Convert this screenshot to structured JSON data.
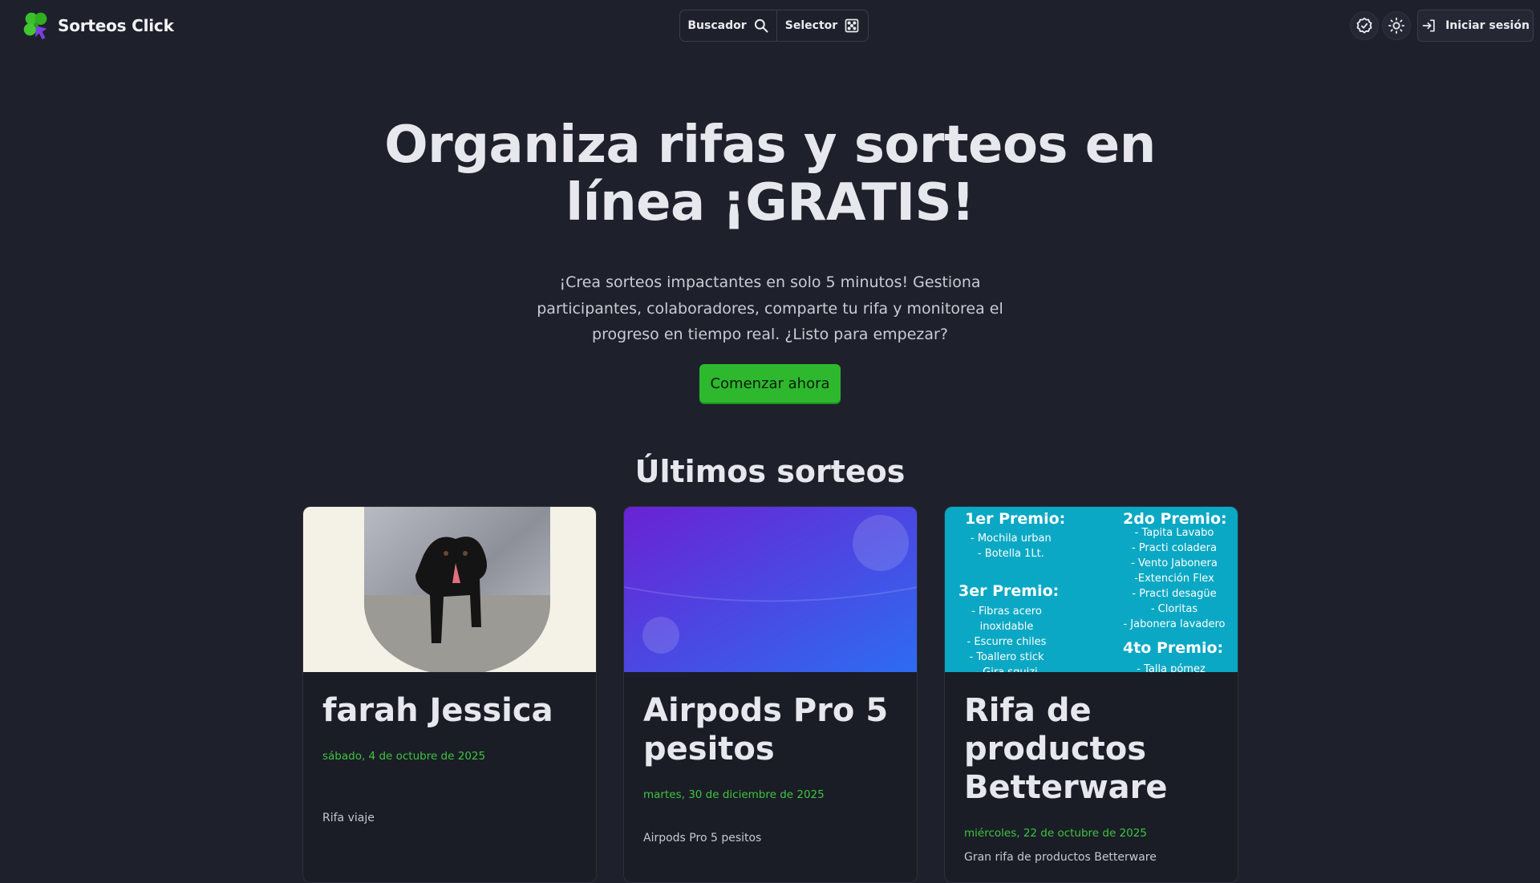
{
  "header": {
    "brand": "Sorteos Click",
    "search_label": "Buscador",
    "selector_label": "Selector",
    "login_label": "Iniciar sesión",
    "icons": [
      "clover-logo-icon",
      "search-icon",
      "dice-icon",
      "verified-badge-icon",
      "sun-icon",
      "login-icon"
    ]
  },
  "hero": {
    "title_line1": "Organiza rifas y sorteos en",
    "title_line2": "línea ¡GRATIS!",
    "subtitle_line1": "¡Crea sorteos impactantes en solo 5 minutos! Gestiona",
    "subtitle_line2": "participantes, colaboradores, comparte tu rifa y monitorea el",
    "subtitle_line3": "progreso en tiempo real. ¿Listo para empezar?",
    "cta_label": "Comenzar ahora"
  },
  "section": {
    "title": "Últimos sorteos"
  },
  "cards": [
    {
      "title": "farah Jessica",
      "date": "sábado, 4 de octubre de 2025",
      "description": "Rifa viaje"
    },
    {
      "title_line1": "Airpods Pro 5",
      "title_line2": "pesitos",
      "date": "martes, 30 de diciembre de 2025",
      "description": "Airpods Pro 5 pesitos"
    },
    {
      "title_line1": "Rifa de",
      "title_line2": "productos",
      "title_line3": "Betterware",
      "date": "miércoles, 22 de octubre de 2025",
      "description": "Gran rifa de productos Betterware",
      "prize_image": {
        "p1_title": "1er Premio:",
        "p1_items": [
          "- Mochila urban",
          "- Botella 1Lt."
        ],
        "p2_title": "2do Premio:",
        "p2_items": [
          "- Tapita Lavabo",
          "- Practi coladera",
          "- Vento Jabonera",
          "-Extención Flex",
          "- Practi desagüe",
          "- Cloritas",
          "- Jabonera lavadero"
        ],
        "p3_title": "3er Premio:",
        "p3_items": [
          "- Fibras acero",
          "inoxidable",
          "- Escurre chiles",
          "- Toallero stick",
          "- Gira squizi"
        ],
        "p4_title": "4to Premio:",
        "p4_items": [
          "- Talla pómez"
        ]
      }
    }
  ],
  "colors": {
    "background": "#1e212b",
    "accent_green": "#2db82d",
    "date_green": "#3ec43e",
    "card_bg": "#1a1d26",
    "prize_bg": "#0aa8c4"
  }
}
